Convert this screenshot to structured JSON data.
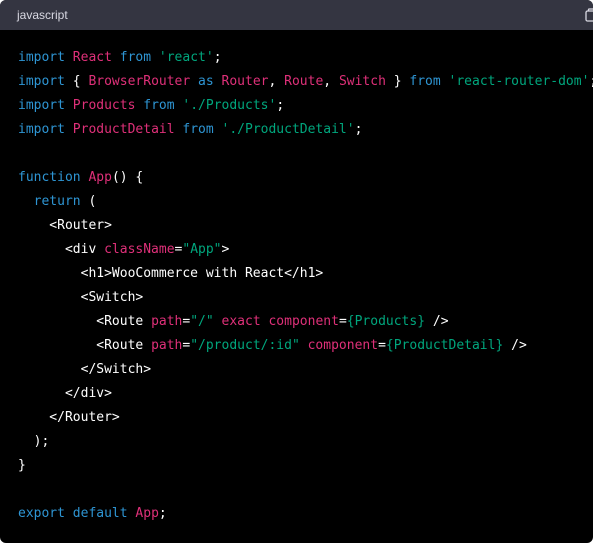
{
  "header": {
    "language": "javascript"
  },
  "code": {
    "lines": [
      [
        {
          "c": "kw",
          "t": "import"
        },
        {
          "c": "txt",
          "t": " "
        },
        {
          "c": "id",
          "t": "React"
        },
        {
          "c": "txt",
          "t": " "
        },
        {
          "c": "kw",
          "t": "from"
        },
        {
          "c": "txt",
          "t": " "
        },
        {
          "c": "str",
          "t": "'react'"
        },
        {
          "c": "txt",
          "t": ";"
        }
      ],
      [
        {
          "c": "kw",
          "t": "import"
        },
        {
          "c": "txt",
          "t": " { "
        },
        {
          "c": "id",
          "t": "BrowserRouter"
        },
        {
          "c": "txt",
          "t": " "
        },
        {
          "c": "kw",
          "t": "as"
        },
        {
          "c": "txt",
          "t": " "
        },
        {
          "c": "id",
          "t": "Router"
        },
        {
          "c": "txt",
          "t": ", "
        },
        {
          "c": "id",
          "t": "Route"
        },
        {
          "c": "txt",
          "t": ", "
        },
        {
          "c": "id",
          "t": "Switch"
        },
        {
          "c": "txt",
          "t": " } "
        },
        {
          "c": "kw",
          "t": "from"
        },
        {
          "c": "txt",
          "t": " "
        },
        {
          "c": "str",
          "t": "'react-router-dom'"
        },
        {
          "c": "txt",
          "t": ";"
        }
      ],
      [
        {
          "c": "kw",
          "t": "import"
        },
        {
          "c": "txt",
          "t": " "
        },
        {
          "c": "id",
          "t": "Products"
        },
        {
          "c": "txt",
          "t": " "
        },
        {
          "c": "kw",
          "t": "from"
        },
        {
          "c": "txt",
          "t": " "
        },
        {
          "c": "str",
          "t": "'./Products'"
        },
        {
          "c": "txt",
          "t": ";"
        }
      ],
      [
        {
          "c": "kw",
          "t": "import"
        },
        {
          "c": "txt",
          "t": " "
        },
        {
          "c": "id",
          "t": "ProductDetail"
        },
        {
          "c": "txt",
          "t": " "
        },
        {
          "c": "kw",
          "t": "from"
        },
        {
          "c": "txt",
          "t": " "
        },
        {
          "c": "str",
          "t": "'./ProductDetail'"
        },
        {
          "c": "txt",
          "t": ";"
        }
      ],
      [],
      [
        {
          "c": "kw",
          "t": "function"
        },
        {
          "c": "txt",
          "t": " "
        },
        {
          "c": "id",
          "t": "App"
        },
        {
          "c": "txt",
          "t": "() {"
        }
      ],
      [
        {
          "c": "txt",
          "t": "  "
        },
        {
          "c": "kw",
          "t": "return"
        },
        {
          "c": "txt",
          "t": " ("
        }
      ],
      [
        {
          "c": "txt",
          "t": "    <Router>"
        }
      ],
      [
        {
          "c": "txt",
          "t": "      <div "
        },
        {
          "c": "id",
          "t": "className"
        },
        {
          "c": "txt",
          "t": "="
        },
        {
          "c": "str",
          "t": "\"App\""
        },
        {
          "c": "txt",
          "t": ">"
        }
      ],
      [
        {
          "c": "txt",
          "t": "        <h1>WooCommerce with React</h1>"
        }
      ],
      [
        {
          "c": "txt",
          "t": "        <Switch>"
        }
      ],
      [
        {
          "c": "txt",
          "t": "          <Route "
        },
        {
          "c": "id",
          "t": "path"
        },
        {
          "c": "txt",
          "t": "="
        },
        {
          "c": "str",
          "t": "\"/\""
        },
        {
          "c": "txt",
          "t": " "
        },
        {
          "c": "id",
          "t": "exact"
        },
        {
          "c": "txt",
          "t": " "
        },
        {
          "c": "id",
          "t": "component"
        },
        {
          "c": "txt",
          "t": "="
        },
        {
          "c": "str",
          "t": "{Products}"
        },
        {
          "c": "txt",
          "t": " />"
        }
      ],
      [
        {
          "c": "txt",
          "t": "          <Route "
        },
        {
          "c": "id",
          "t": "path"
        },
        {
          "c": "txt",
          "t": "="
        },
        {
          "c": "str",
          "t": "\"/product/:id\""
        },
        {
          "c": "txt",
          "t": " "
        },
        {
          "c": "id",
          "t": "component"
        },
        {
          "c": "txt",
          "t": "="
        },
        {
          "c": "str",
          "t": "{ProductDetail}"
        },
        {
          "c": "txt",
          "t": " />"
        }
      ],
      [
        {
          "c": "txt",
          "t": "        </Switch>"
        }
      ],
      [
        {
          "c": "txt",
          "t": "      </div>"
        }
      ],
      [
        {
          "c": "txt",
          "t": "    </Router>"
        }
      ],
      [
        {
          "c": "txt",
          "t": "  );"
        }
      ],
      [
        {
          "c": "txt",
          "t": "}"
        }
      ],
      [],
      [
        {
          "c": "kw",
          "t": "export"
        },
        {
          "c": "txt",
          "t": " "
        },
        {
          "c": "kw",
          "t": "default"
        },
        {
          "c": "txt",
          "t": " "
        },
        {
          "c": "id",
          "t": "App"
        },
        {
          "c": "txt",
          "t": ";"
        }
      ]
    ]
  },
  "colors": {
    "keyword": "#2e95d3",
    "identifier": "#df3079",
    "string": "#00a67d",
    "text": "#ffffff",
    "header_bg": "#343541",
    "code_bg": "#000000"
  },
  "icons": {
    "copy": "copy-icon"
  }
}
